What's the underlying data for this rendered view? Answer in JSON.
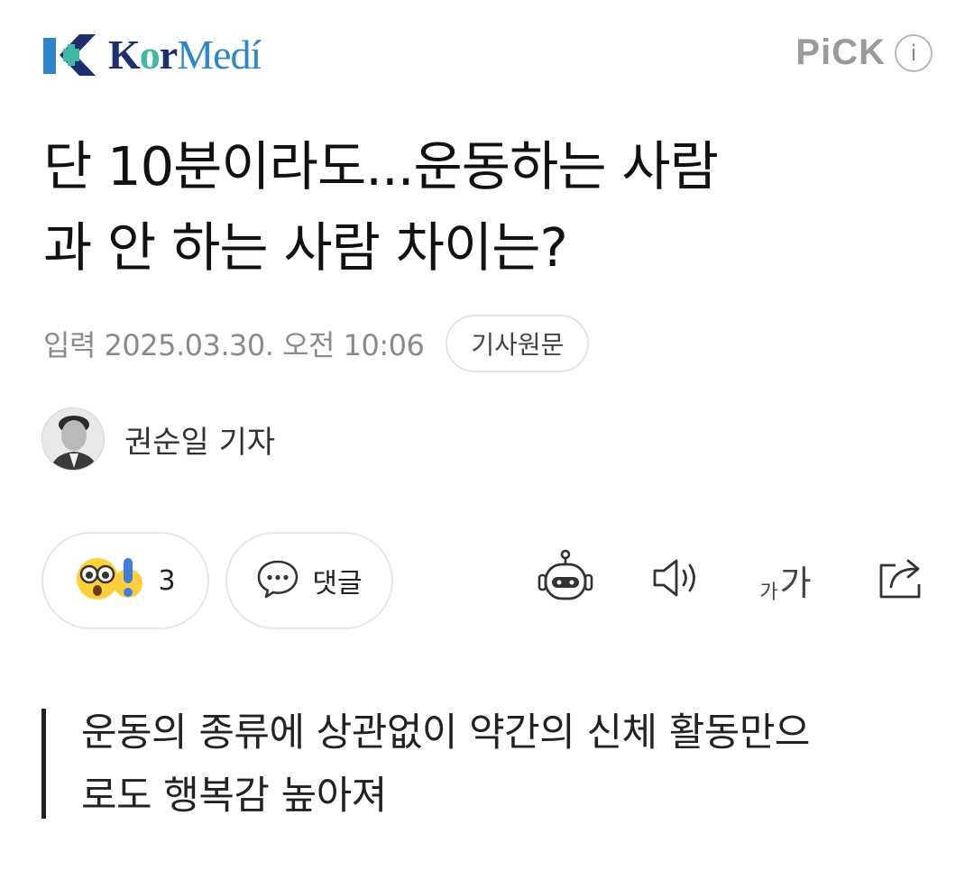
{
  "header": {
    "brand": {
      "letters_k": "K",
      "letters_o": "o",
      "letters_r": "r",
      "letters_medi": "Medí",
      "colors": {
        "navy": "#1d2f6e",
        "blue": "#2e86c9",
        "green": "#3fb9a6"
      }
    },
    "pick_label": "PiCK",
    "info_label": "i"
  },
  "article": {
    "title_line1": "단 10분이라도...운동하는 사람",
    "title_line2": "과 안 하는 사람 차이는?",
    "date": "입력 2025.03.30. 오전 10:06",
    "origin_button": "기사원문",
    "reporter": "권순일 기자",
    "subtitle_line1": "운동의 종류에 상관없이 약간의 신체 활동만으",
    "subtitle_line2": "로도 행복감 높아져"
  },
  "actions": {
    "reaction_count": "3",
    "comment_label": "댓글",
    "font_small": "가",
    "font_big": "가",
    "icons": [
      "surprised-emoji-icon",
      "exclamation-emoji-icon",
      "speech-bubble-icon",
      "robot-summary-icon",
      "speaker-icon",
      "font-size-icon",
      "share-icon"
    ]
  }
}
